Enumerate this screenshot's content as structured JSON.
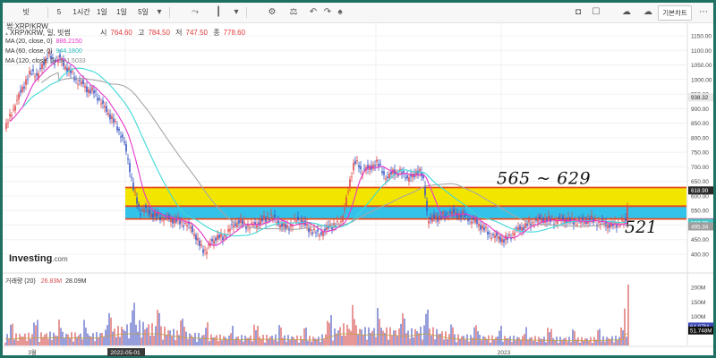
{
  "toolbar": {
    "symbol": "빗썸:XRP/KRW",
    "quantity": "5",
    "interval_1h": "1시간",
    "interval_1d": "1일",
    "interval_1w": "1일",
    "interval_extra": "5일",
    "right_button": "기본차트",
    "icons": [
      "candle-chart-icon",
      "indicators-icon",
      "settings-icon",
      "balance-icon",
      "undo-icon",
      "redo-icon",
      "alert-icon",
      "camera-icon",
      "layout-icon",
      "cloud-save-icon",
      "cloud-load-icon",
      "more-icon"
    ]
  },
  "chart_data": {
    "type": "candlestick",
    "title": "XRP/KRW, 일, 빗썸",
    "ohlc": {
      "open_label": "시",
      "open": "764.60",
      "high_label": "고",
      "high": "784.50",
      "low_label": "저",
      "low": "747.50",
      "close_label": "종",
      "close": "778.60"
    },
    "moving_averages": [
      {
        "name": "MA (20, close, 0)",
        "value": "886.2150",
        "color": "#e535c8"
      },
      {
        "name": "MA (60, close, 0)",
        "value": "944.1800",
        "color": "#38d6d6"
      },
      {
        "name": "MA (120, close, 0)",
        "value": "921.5033",
        "color": "#9e9e9e"
      }
    ],
    "price_axis": {
      "min": 400,
      "max": 1150,
      "ticks": [
        "1150.00",
        "1100.00",
        "1050.00",
        "1000.00",
        "950.00",
        "900.00",
        "850.00",
        "800.00",
        "750.00",
        "700.00",
        "650.00",
        "600.00",
        "550.00",
        "500.00",
        "450.00",
        "400.00"
      ]
    },
    "price_labels": [
      {
        "value": "938.32",
        "bg": "#e8e8e8",
        "color": "#222"
      },
      {
        "value": "618.90",
        "bg": "#2a2a2a",
        "color": "#ffffff"
      },
      {
        "value": "509.66",
        "bg": "#d24a8a",
        "color": "#ffffff"
      },
      {
        "value": "507.70",
        "bg": "#46c7c7",
        "color": "#ffffff"
      },
      {
        "value": "495.34",
        "bg": "#9e9e9e",
        "color": "#ffffff"
      }
    ],
    "date_labels": [
      "3월",
      "2022-05-01",
      "2023"
    ],
    "zones": [
      {
        "name": "yellow-resistance-zone",
        "from": 565,
        "to": 629,
        "color": "#f2e600",
        "border": "#e84a1a"
      },
      {
        "name": "blue-support-zone",
        "from": 521,
        "to": 565,
        "color": "#33c2ea",
        "border": "#e84a1a"
      }
    ],
    "annotations": [
      {
        "text": "565 ~ 629",
        "price": 660
      },
      {
        "text": "521",
        "price": 505
      }
    ],
    "volume": {
      "label": "거래량 (20)",
      "value1": "26.83M",
      "value2": "28.09M",
      "axis_ticks": [
        "200M",
        "150M",
        "100M",
        "50M"
      ],
      "axis_max": 225,
      "price_labels": [
        {
          "value": "64.97M",
          "bg": "#3b47b8",
          "color": "#ffffff"
        },
        {
          "value": "51.748M",
          "bg": "#111111",
          "color": "#ffffff"
        }
      ]
    },
    "keypoints": [
      [
        0,
        830
      ],
      [
        6,
        880
      ],
      [
        12,
        920
      ],
      [
        18,
        965
      ],
      [
        24,
        1000
      ],
      [
        30,
        1030
      ],
      [
        36,
        1010
      ],
      [
        42,
        1055
      ],
      [
        48,
        1085
      ],
      [
        54,
        1060
      ],
      [
        60,
        1075
      ],
      [
        66,
        1045
      ],
      [
        72,
        1030
      ],
      [
        78,
        1000
      ],
      [
        84,
        990
      ],
      [
        92,
        965
      ],
      [
        100,
        955
      ],
      [
        108,
        915
      ],
      [
        114,
        890
      ],
      [
        120,
        860
      ],
      [
        126,
        830
      ],
      [
        132,
        790
      ],
      [
        138,
        710
      ],
      [
        144,
        610
      ],
      [
        150,
        548
      ],
      [
        156,
        555
      ],
      [
        162,
        540
      ],
      [
        170,
        530
      ],
      [
        180,
        523
      ],
      [
        190,
        515
      ],
      [
        200,
        505
      ],
      [
        208,
        490
      ],
      [
        214,
        450
      ],
      [
        218,
        425
      ],
      [
        224,
        410
      ],
      [
        230,
        440
      ],
      [
        236,
        460
      ],
      [
        242,
        455
      ],
      [
        248,
        475
      ],
      [
        254,
        498
      ],
      [
        260,
        512
      ],
      [
        266,
        505
      ],
      [
        272,
        495
      ],
      [
        278,
        500
      ],
      [
        284,
        510
      ],
      [
        290,
        520
      ],
      [
        296,
        530
      ],
      [
        302,
        518
      ],
      [
        308,
        498
      ],
      [
        314,
        492
      ],
      [
        320,
        500
      ],
      [
        326,
        520
      ],
      [
        332,
        510
      ],
      [
        338,
        490
      ],
      [
        344,
        478
      ],
      [
        350,
        470
      ],
      [
        356,
        478
      ],
      [
        362,
        498
      ],
      [
        368,
        500
      ],
      [
        374,
        505
      ],
      [
        378,
        548
      ],
      [
        382,
        600
      ],
      [
        386,
        665
      ],
      [
        390,
        725
      ],
      [
        394,
        705
      ],
      [
        398,
        680
      ],
      [
        402,
        700
      ],
      [
        406,
        690
      ],
      [
        410,
        700
      ],
      [
        414,
        720
      ],
      [
        418,
        700
      ],
      [
        422,
        680
      ],
      [
        426,
        660
      ],
      [
        430,
        670
      ],
      [
        434,
        690
      ],
      [
        438,
        675
      ],
      [
        442,
        680
      ],
      [
        446,
        675
      ],
      [
        450,
        660
      ],
      [
        456,
        668
      ],
      [
        460,
        690
      ],
      [
        464,
        680
      ],
      [
        468,
        640
      ],
      [
        472,
        520
      ],
      [
        476,
        515
      ],
      [
        480,
        530
      ],
      [
        484,
        525
      ],
      [
        488,
        530
      ],
      [
        492,
        535
      ],
      [
        498,
        545
      ],
      [
        504,
        535
      ],
      [
        510,
        538
      ],
      [
        516,
        525
      ],
      [
        522,
        515
      ],
      [
        528,
        505
      ],
      [
        534,
        490
      ],
      [
        540,
        470
      ],
      [
        546,
        462
      ],
      [
        552,
        455
      ],
      [
        558,
        448
      ],
      [
        562,
        455
      ],
      [
        566,
        470
      ],
      [
        570,
        480
      ],
      [
        576,
        490
      ],
      [
        582,
        500
      ],
      [
        588,
        508
      ],
      [
        594,
        515
      ],
      [
        600,
        520
      ],
      [
        606,
        518
      ],
      [
        612,
        512
      ],
      [
        618,
        515
      ],
      [
        624,
        520
      ],
      [
        630,
        515
      ],
      [
        636,
        512
      ],
      [
        642,
        510
      ],
      [
        648,
        515
      ],
      [
        654,
        520
      ],
      [
        660,
        510
      ],
      [
        666,
        505
      ],
      [
        672,
        502
      ],
      [
        678,
        498
      ],
      [
        684,
        505
      ],
      [
        690,
        510
      ],
      [
        694,
        512
      ],
      [
        696,
        620
      ]
    ],
    "volume_keypoints": [
      [
        0,
        25
      ],
      [
        50,
        30
      ],
      [
        100,
        28
      ],
      [
        150,
        55
      ],
      [
        200,
        30
      ],
      [
        250,
        22
      ],
      [
        300,
        24
      ],
      [
        350,
        20
      ],
      [
        380,
        50
      ],
      [
        400,
        40
      ],
      [
        420,
        42
      ],
      [
        450,
        35
      ],
      [
        470,
        45
      ],
      [
        500,
        25
      ],
      [
        550,
        22
      ],
      [
        600,
        20
      ],
      [
        650,
        18
      ],
      [
        690,
        22
      ],
      [
        696,
        80
      ],
      [
        698,
        210
      ]
    ]
  }
}
